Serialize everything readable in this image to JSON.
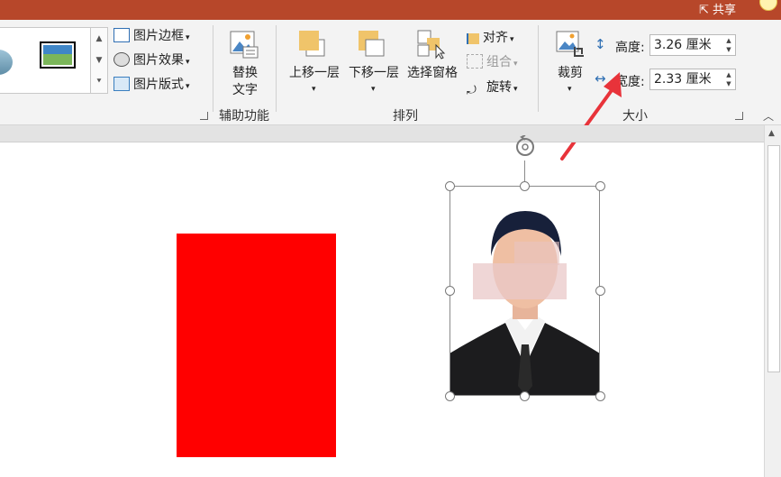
{
  "topbar": {
    "share_label": "共享"
  },
  "picture_styles": {
    "border_label": "图片边框",
    "effects_label": "图片效果",
    "layout_label": "图片版式"
  },
  "accessibility": {
    "alt_text_label_line1": "替换",
    "alt_text_label_line2": "文字",
    "group_label": "辅助功能"
  },
  "arrange": {
    "bring_forward_label": "上移一层",
    "send_backward_label": "下移一层",
    "selection_pane_label": "选择窗格",
    "align_label": "对齐",
    "group_label_btn": "组合",
    "rotate_label": "旋转",
    "group_label": "排列"
  },
  "size": {
    "crop_label": "裁剪",
    "height_label": "高度:",
    "height_value": "3.26 厘米",
    "width_label": "宽度:",
    "width_value": "2.33 厘米",
    "group_label": "大小"
  },
  "colors": {
    "title_bar": "#b7472a",
    "ribbon_bg": "#f3f3f3",
    "shape_fill": "#ff0000",
    "annotation_arrow": "#e8333a"
  }
}
